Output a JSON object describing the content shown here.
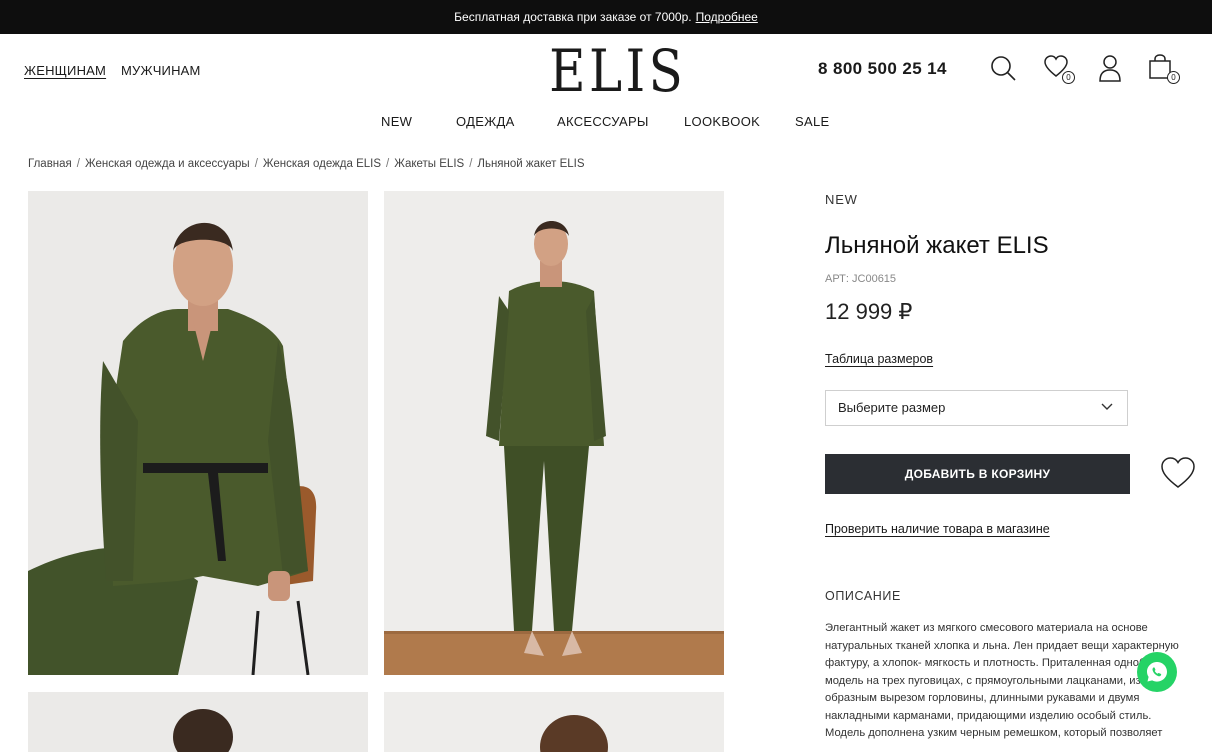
{
  "promo": {
    "text": "Бесплатная доставка при заказе от 7000р.",
    "link": "Подробнее"
  },
  "header": {
    "gender_women": "ЖЕНЩИНАМ",
    "gender_men": "МУЖЧИНАМ",
    "logo": "ELIS",
    "phone": "8 800 500 25 14",
    "wishlist_count": "0",
    "cart_count": "0"
  },
  "nav": [
    "NEW",
    "ОДЕЖДА",
    "АКСЕССУАРЫ",
    "LOOKBOOK",
    "SALE"
  ],
  "breadcrumbs": [
    "Главная",
    "Женская одежда и аксессуары",
    "Женская одежда ELIS",
    "Жакеты ELIS",
    "Льняной жакет ELIS"
  ],
  "product": {
    "badge": "NEW",
    "title": "Льняной жакет ELIS",
    "article": "АРТ: JC00615",
    "price": "12 999 ₽",
    "size_table_link": "Таблица размеров",
    "size_select_placeholder": "Выберите размер",
    "add_to_cart": "ДОБАВИТЬ В КОРЗИНУ",
    "check_store_link": "Проверить наличие товара в магазине",
    "description_heading": "ОПИСАНИЕ",
    "description_lines": [
      "Элегантный жакет из мягкого смесового материала на основе",
      "натуральных тканей хлопка и льна. Лен придает вещи характерную",
      "фактуру, а хлопок- мягкость и плотность. Приталенная однобор",
      "модель на трех пуговицах, с прямоугольными лацканами, изящ",
      "образным вырезом горловины, длинными рукавами и двумя",
      "накладными карманами, придающими изделию особый стиль.",
      "Модель дополнена узким черным ремешком, который позволяет"
    ]
  },
  "colors": {
    "promo_bg": "#0e0e0e",
    "button_bg": "#2b2e33",
    "jacket_green": "#4a5a2c",
    "whatsapp": "#25d366"
  },
  "icons": [
    "search-icon",
    "heart-icon",
    "user-icon",
    "bag-icon",
    "chevron-down-icon",
    "whatsapp-icon"
  ]
}
